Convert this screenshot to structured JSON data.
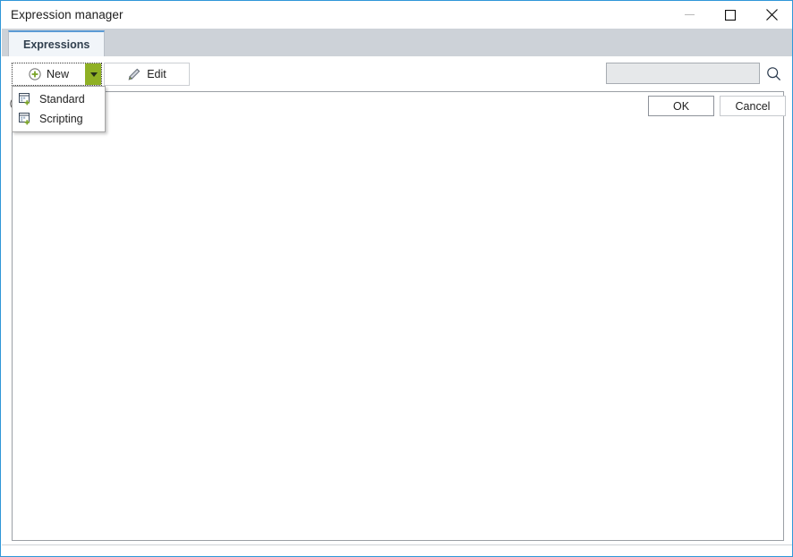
{
  "window": {
    "title": "Expression manager",
    "controls": {
      "minimize": "minimize-button",
      "maximize": "maximize-button",
      "close": "close-button"
    },
    "accent_border": "#2f97d8"
  },
  "tabs": [
    {
      "label": "Expressions",
      "active": true
    }
  ],
  "toolbar": {
    "new": {
      "label": "New",
      "icon": "circle-plus-icon",
      "dropdown_arrow": "chevron-down-icon",
      "dropdown_color": "#8fb024",
      "focused": true,
      "expanded": true
    },
    "edit": {
      "label": "Edit",
      "icon": "pencil-icon"
    },
    "search": {
      "value": "",
      "placeholder": "",
      "icon": "search-icon",
      "enabled": false
    }
  },
  "new_menu": {
    "items": [
      {
        "label": "Standard",
        "icon": "new-expression-icon"
      },
      {
        "label": "Scripting",
        "icon": "new-script-icon"
      }
    ]
  },
  "content": {
    "items": [],
    "empty": true
  },
  "footer": {
    "help": {
      "icon": "help-circle-icon"
    },
    "ok": {
      "label": "OK",
      "default": true
    },
    "cancel": {
      "label": "Cancel"
    }
  }
}
